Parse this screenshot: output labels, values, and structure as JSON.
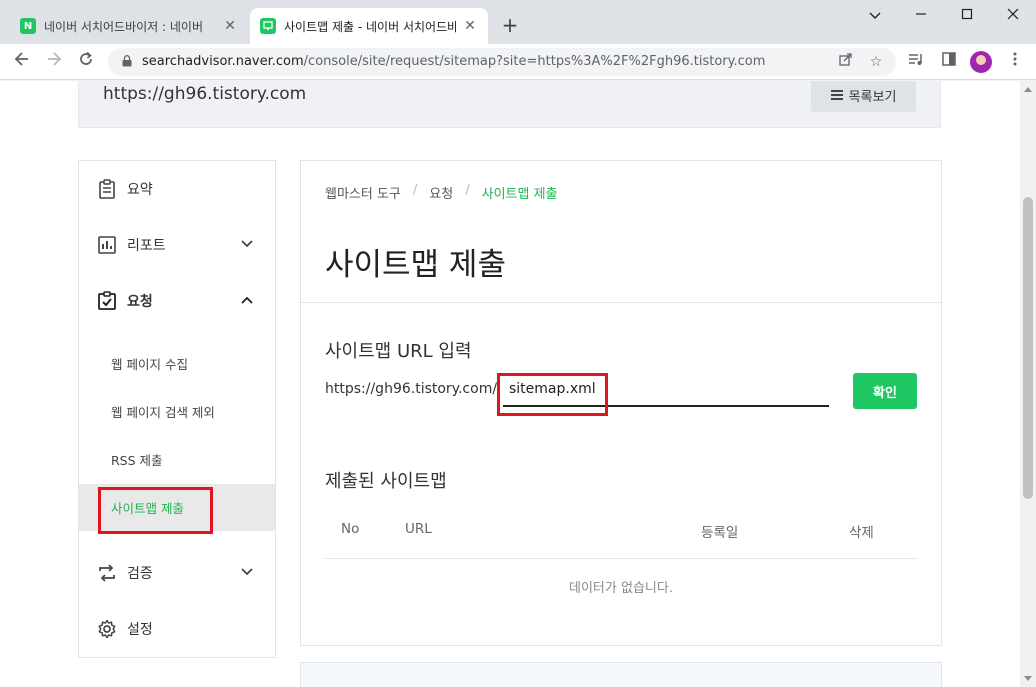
{
  "browser": {
    "tabs": [
      {
        "title": "네이버 서치어드바이저 : 네이버",
        "favicon": "naver-n-icon",
        "favicon_letter": "N",
        "active": false
      },
      {
        "title": "사이트맵 제출 - 네이버 서치어드바",
        "favicon": "search-advisor-icon",
        "active": true
      }
    ],
    "new_tab": "+",
    "url_host": "searchadvisor.naver.com",
    "url_path": "/console/site/request/sitemap?site=https%3A%2F%2Fgh96.tistory.com",
    "colors": {
      "naver_green": "#1ec763"
    }
  },
  "site": {
    "url": "https://gh96.tistory.com",
    "list_button": "목록보기"
  },
  "sidebar": {
    "items": [
      {
        "label": "요약",
        "icon": "clipboard-icon"
      },
      {
        "label": "리포트",
        "icon": "bar-chart-icon",
        "chevron": "down"
      },
      {
        "label": "요청",
        "icon": "checklist-icon",
        "chevron": "up"
      },
      {
        "label": "검증",
        "icon": "sync-arrows-icon",
        "chevron": "down"
      },
      {
        "label": "설정",
        "icon": "gear-icon"
      }
    ],
    "sub_items": [
      {
        "label": "웹 페이지 수집"
      },
      {
        "label": "웹 페이지 검색 제외"
      },
      {
        "label": "RSS 제출"
      },
      {
        "label": "사이트맵 제출",
        "selected": true
      }
    ]
  },
  "main": {
    "breadcrumb": [
      "웹마스터 도구",
      "요청",
      "사이트맵 제출"
    ],
    "title": "사이트맵 제출",
    "input_section_title": "사이트맵 URL 입력",
    "url_prefix": "https://gh96.tistory.com/",
    "sitemap_input_value": "sitemap.xml",
    "confirm_label": "확인",
    "submitted_section_title": "제출된 사이트맵",
    "table_headers": [
      "No",
      "URL",
      "등록일",
      "삭제"
    ],
    "empty_message": "데이터가 없습니다."
  }
}
